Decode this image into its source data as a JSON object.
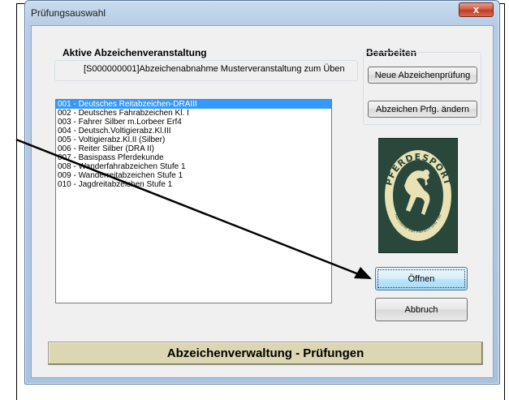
{
  "window": {
    "title": "Prüfungsauswahl",
    "close_label": "x"
  },
  "active_event": {
    "group_label": "Aktive Abzeichenveranstaltung",
    "value": "[S000000001]Abzeichenabnahme Musterveranstaltung zum Üben"
  },
  "edit": {
    "group_label": "Bearbeiten",
    "new_button": "Neue Abzeichenprüfung",
    "change_button": "Abzeichen Prfg. ändern"
  },
  "exam_list": {
    "selected_index": 0,
    "items": [
      "001 - Deutsches Reitabzeichen-DRAIII",
      "002 - Deutsches Fahrabzeichen Kl. I",
      "003 - Fahrer Silber m.Lorbeer Erf4",
      "004 - Deutsch.Voltigierabz.Kl.III",
      "005 - Voltigierabz.Kl.II (Silber)",
      "006 - Reiter Silber (DRA II)",
      "007 - Basispass Pferdekunde",
      "008 - Wanderfahrabzeichen Stufe 1",
      "009 - Wanderreitabzeichen Stufe 1",
      "010 - Jagdreitabzeichen Stufe 1"
    ]
  },
  "logo": {
    "top_text": "PFERDESPORT",
    "bottom_text": "Harmonie von Mensch und Tier"
  },
  "actions": {
    "open_button": "Öffnen",
    "cancel_button": "Abbruch"
  },
  "footer": {
    "text": "Abzeichenverwaltung - Prüfungen"
  },
  "colors": {
    "selection": "#3399ff",
    "footer_bg": "#dcd6b2",
    "logo_bg": "#29473b",
    "logo_ring": "#e8e2b4"
  }
}
